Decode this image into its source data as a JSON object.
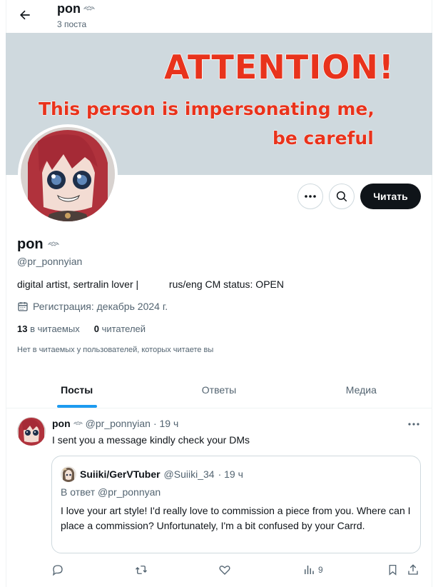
{
  "header": {
    "name": "pon",
    "post_count": "3 поста"
  },
  "banner": {
    "title": "ATTENTION!",
    "line1": "This person is impersonating me,",
    "line2": "be careful"
  },
  "profile": {
    "name": "pon",
    "handle": "@pr_ponnyian",
    "bio": "digital artist, sertralin lover |           rus/eng CM status: OPEN",
    "joined": "Регистрация: декабрь 2024 г.",
    "following_count": "13",
    "following_label": "в читаемых",
    "followers_count": "0",
    "followers_label": "читателей",
    "note": "Нет в читаемых у пользователей, которых читаете вы",
    "follow_button": "Читать"
  },
  "tabs": [
    {
      "label": "Посты",
      "active": true
    },
    {
      "label": "Ответы",
      "active": false
    },
    {
      "label": "Медиа",
      "active": false
    }
  ],
  "tweet": {
    "name": "pon",
    "handle": "@pr_ponnyian",
    "time": "· 19 ч",
    "text": "I sent you a message kindly check your DMs",
    "quote": {
      "name": "Suiiki/GerVTuber",
      "handle": "@Suiiki_34",
      "time": "· 19 ч",
      "reply_to": "В ответ @pr_ponnyan",
      "text": "I love your art style! I'd really love to commission a piece from you. Where can I place a commission? Unfortunately, I'm a bit confused by your Carrd."
    },
    "views": "9"
  },
  "colors": {
    "attention_red": "#e8331c",
    "accent_blue": "#1d9bf0",
    "banner_gray": "#cfd9de"
  }
}
